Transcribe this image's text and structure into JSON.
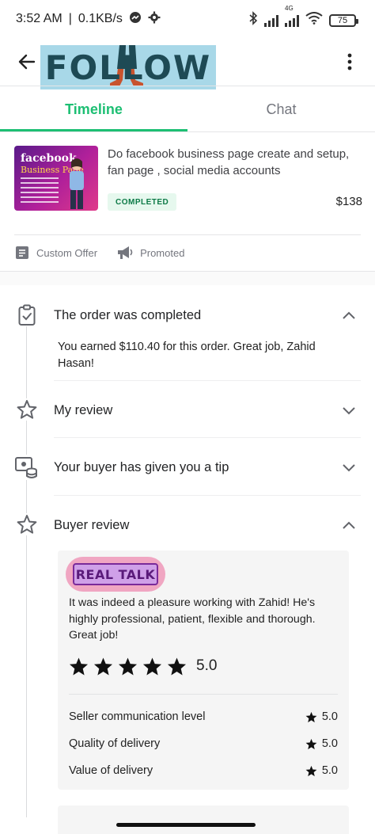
{
  "status_bar": {
    "time": "3:52 AM",
    "speed": "0.1KB/s",
    "network_label": "4G",
    "battery": "75"
  },
  "app_bar": {
    "logo_text": "FOLLOW",
    "back_icon": "arrow-left-icon",
    "more_icon": "more-vertical-icon"
  },
  "tabs": [
    {
      "label": "Timeline",
      "active": true
    },
    {
      "label": "Chat",
      "active": false
    }
  ],
  "order": {
    "thumbnail_title": "facebook",
    "thumbnail_subtitle": "Business Page",
    "title": "Do facebook business page create and setup, fan page , social media accounts",
    "status": "COMPLETED",
    "price": "$138"
  },
  "meta": {
    "custom_offer": "Custom Offer",
    "promoted": "Promoted"
  },
  "timeline": {
    "completed": {
      "title": "The order was completed",
      "body": "You earned $110.40 for this order. Great job, Zahid Hasan!",
      "expanded": true
    },
    "my_review": {
      "title": "My review",
      "expanded": false
    },
    "tip": {
      "title": "Your buyer has given you a tip",
      "expanded": false
    },
    "buyer_review": {
      "title": "Buyer review",
      "expanded": true,
      "avatar_text": "REAL TALK",
      "text": "It was indeed a pleasure working with Zahid! He's highly professional, patient, flexible and thorough.  Great job!",
      "rating": "5.0",
      "stars": 5,
      "sub_ratings": [
        {
          "label": "Seller communication level",
          "value": "5.0"
        },
        {
          "label": "Quality of delivery",
          "value": "5.0"
        },
        {
          "label": "Value of delivery",
          "value": "5.0"
        }
      ]
    }
  },
  "colors": {
    "accent": "#1dbf73",
    "badge_bg": "#e6f8ee",
    "badge_text": "#0d7a47"
  }
}
